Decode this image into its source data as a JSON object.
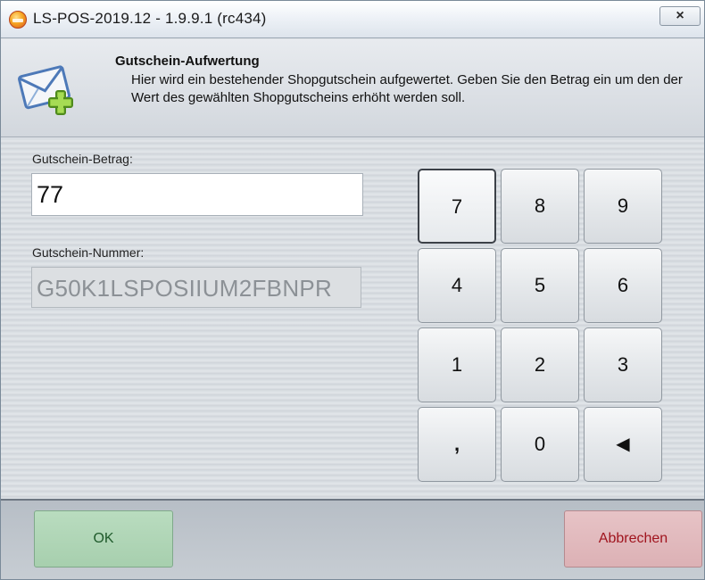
{
  "window": {
    "title": "LS-POS-2019.12 - 1.9.9.1 (rc434)",
    "close_glyph": "×",
    "app_icon": "pos-app-icon"
  },
  "header": {
    "icon": "envelope-plus-icon",
    "title": "Gutschein-Aufwertung",
    "description": "Hier wird ein bestehender Shopgutschein aufgewertet. Geben Sie den Betrag ein um den der Wert des gewählten Shopgutscheins erhöht werden soll."
  },
  "form": {
    "amount_label": "Gutschein-Betrag:",
    "amount_value": "77",
    "number_label": "Gutschein-Nummer:",
    "number_value": "G50K1LSPOSIIUM2FBNPR"
  },
  "keypad": {
    "keys": [
      "7",
      "8",
      "9",
      "4",
      "5",
      "6",
      "1",
      "2",
      "3",
      ",",
      "0",
      "◀"
    ],
    "backspace_icon": "backspace-left-triangle-icon"
  },
  "footer": {
    "ok_label": "OK",
    "cancel_label": "Abbrechen"
  },
  "colors": {
    "ok_bg": "#a7cfae",
    "cancel_bg": "#dcb1b5",
    "cancel_text": "#a0141e"
  }
}
